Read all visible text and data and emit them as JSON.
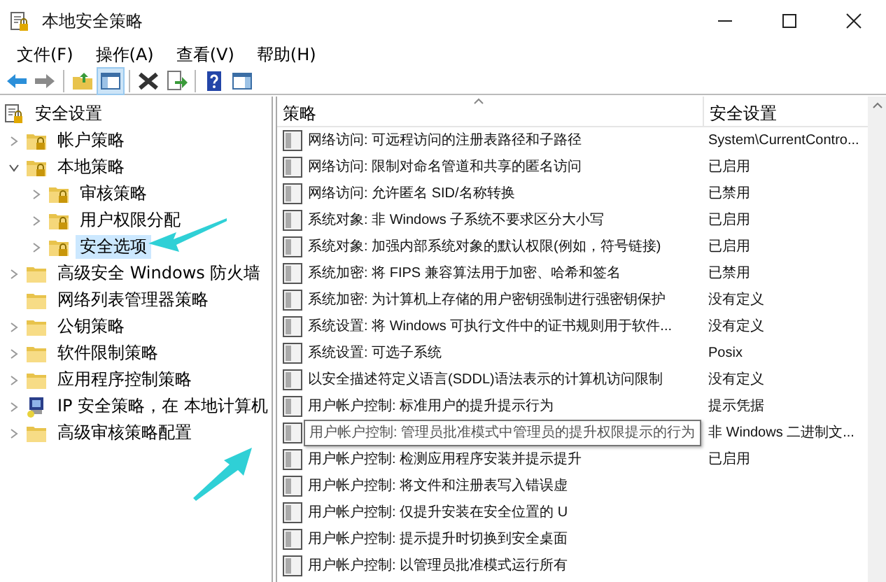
{
  "window": {
    "title": "本地安全策略"
  },
  "menu": [
    "文件(F)",
    "操作(A)",
    "查看(V)",
    "帮助(H)"
  ],
  "toolbar": [
    {
      "kind": "back",
      "selected": false
    },
    {
      "kind": "forward",
      "selected": false
    },
    {
      "kind": "sep"
    },
    {
      "kind": "up",
      "selected": false
    },
    {
      "kind": "tree",
      "selected": true
    },
    {
      "kind": "sep"
    },
    {
      "kind": "delete",
      "selected": false
    },
    {
      "kind": "export",
      "selected": false
    },
    {
      "kind": "sep"
    },
    {
      "kind": "help",
      "selected": false
    },
    {
      "kind": "pane",
      "selected": false
    }
  ],
  "tree": [
    {
      "label": "安全设置",
      "kind": "root",
      "selected": false,
      "children": [
        {
          "label": "帐户策略",
          "kind": "policy",
          "expanded": false,
          "selected": false
        },
        {
          "label": "本地策略",
          "kind": "policy",
          "expanded": true,
          "selected": false,
          "children": [
            {
              "label": "审核策略",
              "kind": "policy",
              "expanded": false,
              "selected": false
            },
            {
              "label": "用户权限分配",
              "kind": "policy",
              "expanded": false,
              "selected": false
            },
            {
              "label": "安全选项",
              "kind": "policy",
              "expanded": false,
              "selected": true
            }
          ]
        },
        {
          "label": "高级安全 Windows 防火墙",
          "kind": "folder",
          "expanded": false,
          "selected": false
        },
        {
          "label": "网络列表管理器策略",
          "kind": "folder",
          "selected": false
        },
        {
          "label": "公钥策略",
          "kind": "folder",
          "expanded": false,
          "selected": false
        },
        {
          "label": "软件限制策略",
          "kind": "folder",
          "expanded": false,
          "selected": false
        },
        {
          "label": "应用程序控制策略",
          "kind": "folder",
          "expanded": false,
          "selected": false
        },
        {
          "label": "IP 安全策略，在 本地计算机",
          "kind": "ip",
          "expanded": false,
          "selected": false
        },
        {
          "label": "高级审核策略配置",
          "kind": "folder",
          "expanded": false,
          "selected": false
        }
      ]
    }
  ],
  "table": {
    "columns": [
      "策略",
      "安全设置"
    ],
    "rows": [
      {
        "policy": "网络访问: 可远程访问的注册表路径和子路径",
        "setting": "System\\CurrentContro..."
      },
      {
        "policy": "网络访问: 限制对命名管道和共享的匿名访问",
        "setting": "已启用"
      },
      {
        "policy": "网络访问: 允许匿名 SID/名称转换",
        "setting": "已禁用"
      },
      {
        "policy": "系统对象: 非 Windows 子系统不要求区分大小写",
        "setting": "已启用"
      },
      {
        "policy": "系统对象: 加强内部系统对象的默认权限(例如，符号链接)",
        "setting": "已启用"
      },
      {
        "policy": "系统加密: 将 FIPS 兼容算法用于加密、哈希和签名",
        "setting": "已禁用"
      },
      {
        "policy": "系统加密: 为计算机上存储的用户密钥强制进行强密钥保护",
        "setting": "没有定义"
      },
      {
        "policy": "系统设置: 将 Windows 可执行文件中的证书规则用于软件...",
        "setting": "没有定义"
      },
      {
        "policy": "系统设置: 可选子系统",
        "setting": "Posix"
      },
      {
        "policy": "以安全描述符定义语言(SDDL)语法表示的计算机访问限制",
        "setting": "没有定义"
      },
      {
        "policy": "用户帐户控制: 标准用户的提升提示行为",
        "setting": "提示凭据"
      },
      {
        "tooltip": "用户帐户控制: 管理员批准模式中管理员的提升权限提示的行为",
        "setting": "非 Windows 二进制文..."
      },
      {
        "policy": "用户帐户控制: 检测应用程序安装并提示提升",
        "setting": "已启用"
      },
      {
        "policy": "用户帐户控制: 将文件和注册表写入错误虚"
      },
      {
        "policy": "用户帐户控制: 仅提升安装在安全位置的 U"
      },
      {
        "policy": "用户帐户控制: 提示提升时切换到安全桌面"
      },
      {
        "policy": "用户帐户控制: 以管理员批准模式运行所有"
      }
    ]
  }
}
